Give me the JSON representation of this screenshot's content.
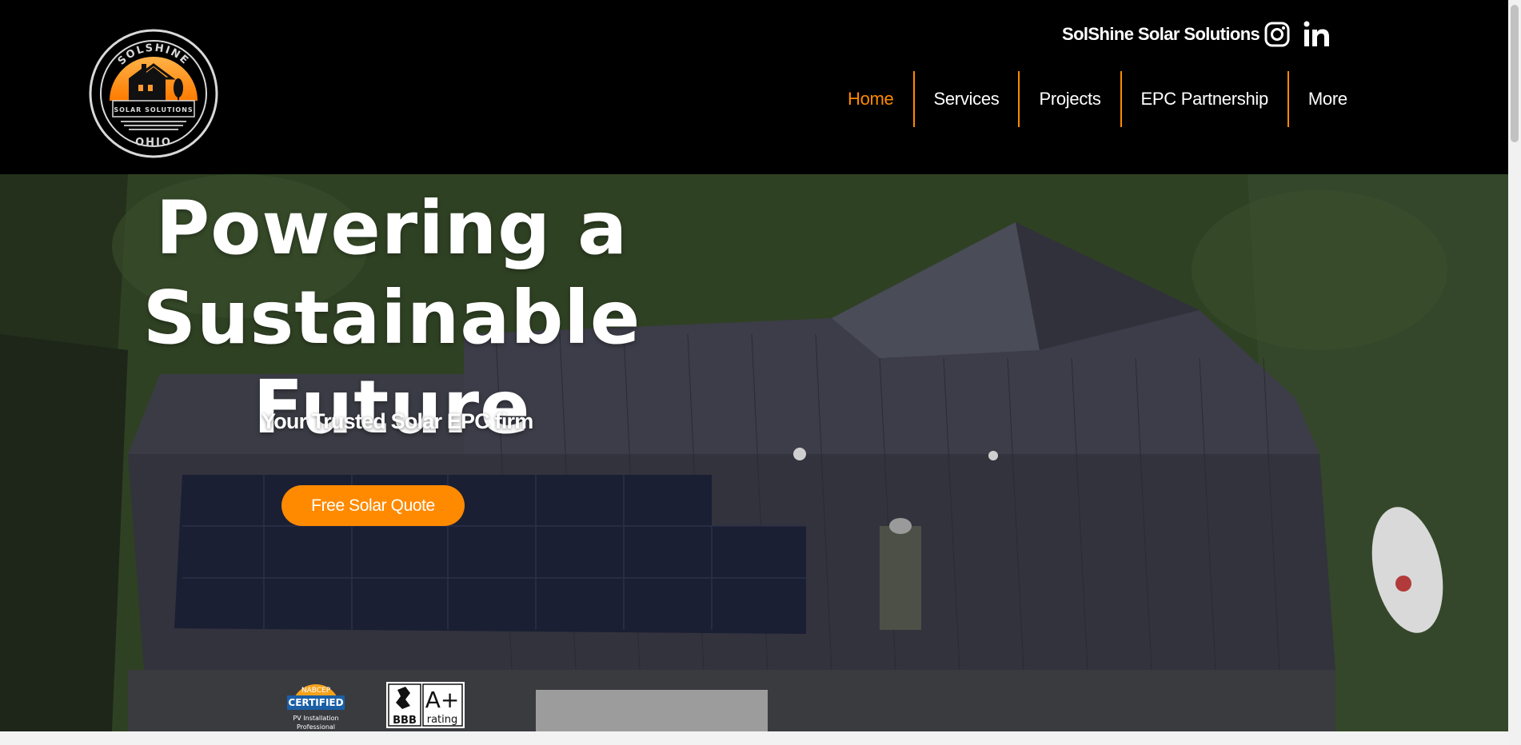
{
  "brand": {
    "name": "SolShine Solar Solutions",
    "logo_top_text": "SOLSHINE",
    "logo_middle_text": "SOLAR SOLUTIONS",
    "logo_bottom_text": "OHIO"
  },
  "social": {
    "instagram_icon": "instagram-icon",
    "linkedin_icon": "linkedin-icon"
  },
  "nav": {
    "items": [
      {
        "label": "Home"
      },
      {
        "label": "Services"
      },
      {
        "label": "Projects"
      },
      {
        "label": "EPC Partnership"
      },
      {
        "label": "More"
      }
    ],
    "active_index": 0
  },
  "hero": {
    "title_line1": "Powering a",
    "title_line2": "Sustainable Future",
    "subtitle": "Your Trusted Solar EPC firm",
    "cta_label": "Free Solar Quote"
  },
  "badges": {
    "nabcep_top": "NABCEP",
    "nabcep_main": "CERTIFIED",
    "nabcep_sub1": "PV Installation",
    "nabcep_sub2": "Professional",
    "bbb_logo": "BBB",
    "bbb_grade": "A+",
    "bbb_rating": "rating"
  },
  "colors": {
    "accent": "#ff8a00",
    "header_bg": "#000000",
    "text": "#ffffff"
  }
}
